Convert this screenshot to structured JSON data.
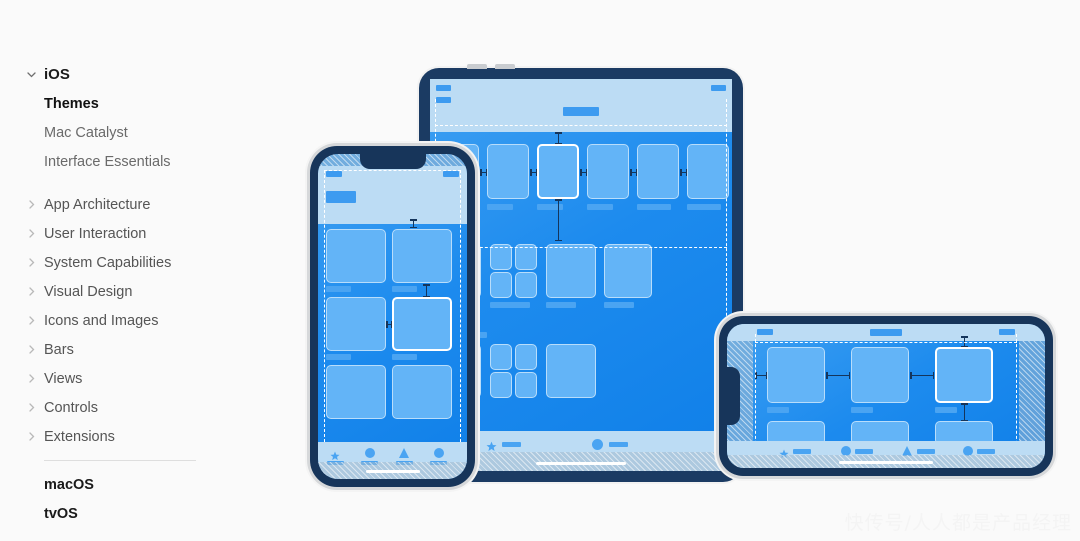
{
  "sidebar": {
    "root": {
      "label": "iOS",
      "icon": "chevron-down-icon",
      "expanded": true
    },
    "children": [
      {
        "label": "Themes",
        "active": true
      },
      {
        "label": "Mac Catalyst",
        "active": false
      },
      {
        "label": "Interface Essentials",
        "active": false
      }
    ],
    "sections": [
      {
        "label": "App Architecture",
        "icon": "chevron-right-icon"
      },
      {
        "label": "User Interaction",
        "icon": "chevron-right-icon"
      },
      {
        "label": "System Capabilities",
        "icon": "chevron-right-icon"
      },
      {
        "label": "Visual Design",
        "icon": "chevron-right-icon"
      },
      {
        "label": "Icons and Images",
        "icon": "chevron-right-icon"
      },
      {
        "label": "Bars",
        "icon": "chevron-right-icon"
      },
      {
        "label": "Views",
        "icon": "chevron-right-icon"
      },
      {
        "label": "Controls",
        "icon": "chevron-right-icon"
      },
      {
        "label": "Extensions",
        "icon": "chevron-right-icon"
      }
    ],
    "platforms": [
      {
        "label": "macOS"
      },
      {
        "label": "tvOS"
      }
    ]
  },
  "illustration": {
    "alt_name": "ios-layout-wireframe-devices",
    "devices": [
      {
        "name": "ipad",
        "orientation": "landscape",
        "tab_items": 2
      },
      {
        "name": "iphone-portrait",
        "orientation": "portrait",
        "tab_items": 4
      },
      {
        "name": "iphone-landscape",
        "orientation": "landscape",
        "tab_items": 4
      }
    ],
    "tab_icons": [
      "star-icon",
      "circle-icon",
      "triangle-icon",
      "circle-icon"
    ]
  },
  "watermark": {
    "text": "快传号/人人都是产品经理"
  },
  "colors": {
    "page_background": "#fafafa",
    "device_frame": "#17355a",
    "screen_blue": "#1d8bee",
    "card_blue": "#63b4f7",
    "navbar_blue": "#bcdcf4",
    "active_text": "#111111",
    "muted_text": "#6a6a6a"
  }
}
